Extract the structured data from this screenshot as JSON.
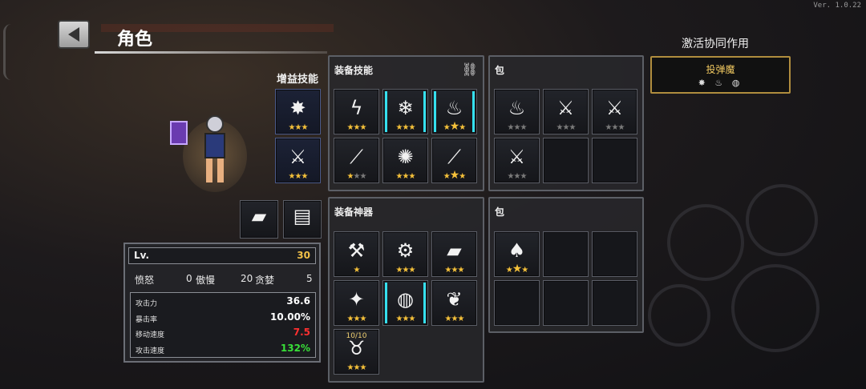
{
  "version": "Ver. 1.0.22",
  "header": {
    "title": "角色"
  },
  "bonus_skills": {
    "label": "增益技能",
    "slots": [
      {
        "icon": "bomb-icon",
        "glyph": "✸",
        "stars": 3,
        "max_stars": 3
      },
      {
        "icon": "sword-icon",
        "glyph": "⚔",
        "stars": 3,
        "max_stars": 3
      }
    ]
  },
  "equip_skills": {
    "label": "装备技能",
    "link_icon": "link-icon",
    "slots": [
      {
        "icon": "lightning-orb-icon",
        "glyph": "ϟ",
        "stars": 3,
        "max_stars": 3,
        "highlight": false
      },
      {
        "icon": "frost-orb-icon",
        "glyph": "❄",
        "stars": 3,
        "max_stars": 3,
        "highlight": true
      },
      {
        "icon": "fire-orb-icon",
        "glyph": "♨",
        "stars": 3,
        "max_stars": 3,
        "highlight": true,
        "big_star": true
      },
      {
        "icon": "spear-icon",
        "glyph": "⟋",
        "stars": 1,
        "max_stars": 3,
        "highlight": false
      },
      {
        "icon": "burst-icon",
        "glyph": "✺",
        "stars": 3,
        "max_stars": 3,
        "highlight": false
      },
      {
        "icon": "spear-icon",
        "glyph": "⟋",
        "stars": 3,
        "max_stars": 3,
        "highlight": false,
        "big_star": true
      }
    ]
  },
  "skill_bag": {
    "label": "包",
    "slots": [
      {
        "icon": "fire-orb-icon",
        "glyph": "♨",
        "stars": 0,
        "max_stars": 3
      },
      {
        "icon": "sword-icon",
        "glyph": "⚔",
        "stars": 0,
        "max_stars": 3
      },
      {
        "icon": "sword-icon",
        "glyph": "⚔",
        "stars": 0,
        "max_stars": 3
      },
      {
        "icon": "sword-icon",
        "glyph": "⚔",
        "stars": 0,
        "max_stars": 3
      },
      null,
      null
    ]
  },
  "equip_artifacts": {
    "label": "装备神器",
    "slots": [
      {
        "icon": "anvil-icon",
        "glyph": "⚒",
        "stars": 1,
        "max_stars": 1
      },
      {
        "icon": "gear-icon",
        "glyph": "⚙",
        "stars": 3,
        "max_stars": 3
      },
      {
        "icon": "purple-book-icon",
        "glyph": "▰",
        "stars": 3,
        "max_stars": 3
      },
      {
        "icon": "medal-icon",
        "glyph": "✦",
        "stars": 3,
        "max_stars": 3
      },
      {
        "icon": "meat-icon",
        "glyph": "◍",
        "stars": 3,
        "max_stars": 3,
        "highlight": true
      },
      {
        "icon": "claw-icon",
        "glyph": "❦",
        "stars": 3,
        "max_stars": 3
      },
      {
        "icon": "pouch-icon",
        "glyph": "♉",
        "stars": 3,
        "max_stars": 3,
        "count": "10/10"
      }
    ]
  },
  "artifact_bag": {
    "label": "包",
    "slots": [
      {
        "icon": "cyan-crystal-icon",
        "glyph": "♠",
        "stars": 3,
        "max_stars": 3,
        "big_star": true
      },
      null,
      null,
      null,
      null,
      null
    ]
  },
  "synergy": {
    "label": "激活协同作用",
    "name": "投弹魔",
    "icons": [
      "bomb-icon",
      "fire-orb-icon",
      "meat-icon"
    ],
    "glyphs": "✸ ♨ ◍"
  },
  "loadout_slots": [
    {
      "icon": "purple-book-icon",
      "glyph": "▰"
    },
    {
      "icon": "chest-icon",
      "glyph": "▤"
    }
  ],
  "stats": {
    "lv_label": "Lv.",
    "lv_value": "30",
    "sins": [
      {
        "label": "愤怒",
        "value": "0"
      },
      {
        "label": "傲慢",
        "value": "20"
      },
      {
        "label": "贪婪",
        "value": "5"
      }
    ],
    "rows": [
      {
        "label": "攻击力",
        "value": "36.6",
        "color": "#ffffff"
      },
      {
        "label": "暴击率",
        "value": "10.00%",
        "color": "#ffffff"
      },
      {
        "label": "移动速度",
        "value": "7.5",
        "color": "#ff3030"
      },
      {
        "label": "攻击速度",
        "value": "132%",
        "color": "#38e038"
      }
    ]
  }
}
